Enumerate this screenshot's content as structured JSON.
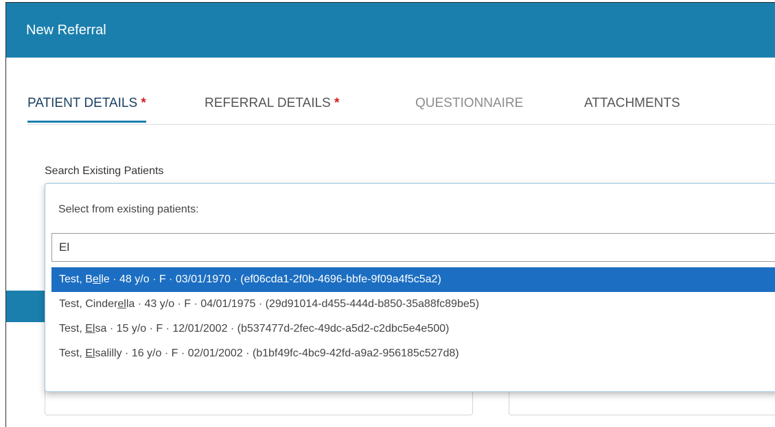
{
  "header": {
    "title": "New Referral"
  },
  "tabs": [
    {
      "label": "PATIENT DETAILS",
      "required_mark": "*"
    },
    {
      "label": "REFERRAL DETAILS",
      "required_mark": "*"
    },
    {
      "label": "QUESTIONNAIRE"
    },
    {
      "label": "ATTACHMENTS"
    }
  ],
  "search": {
    "label": "Search Existing Patients",
    "dropdown_header": "Select from existing patients:",
    "query": "El"
  },
  "results": [
    {
      "pre": "Test, B",
      "match": "el",
      "post": "le · 48 y/o · F · 03/01/1970 · (ef06cda1-2f0b-4696-bbfe-9f09a4f5c5a2)",
      "selected": true
    },
    {
      "pre": "Test, Cinder",
      "match": "el",
      "post": "la · 43 y/o · F · 04/01/1975 · (29d91014-d455-444d-b850-35a88fc89be5)",
      "selected": false
    },
    {
      "pre": "Test, ",
      "match": "El",
      "post": "sa · 15 y/o · F · 12/01/2002 · (b537477d-2fec-49dc-a5d2-c2dbc5e4e500)",
      "selected": false
    },
    {
      "pre": "Test, ",
      "match": "El",
      "post": "salilly · 16 y/o · F · 02/01/2002 · (b1bf49fc-4bc9-42fd-a9a2-956185c527d8)",
      "selected": false
    }
  ],
  "colors": {
    "header": "#1a7fad",
    "selected_row": "#1c6ec2",
    "required": "#d11f1f"
  }
}
